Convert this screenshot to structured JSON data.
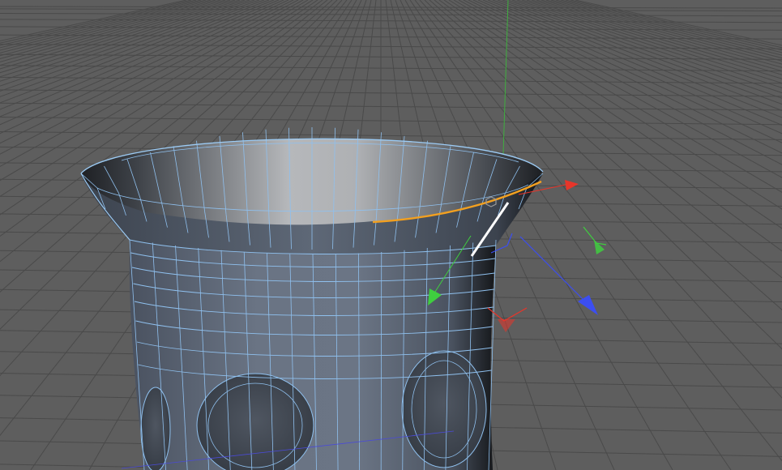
{
  "viewport": {
    "kind": "3d-perspective",
    "background_color": "#5e5e5e",
    "grid_color": "#4a4a4a",
    "wire_color": "#8fc0ee",
    "selection_color": "#f2a020",
    "active_edge_color": "#ffffff"
  },
  "axis_colors": {
    "x": "#e8352a",
    "y": "#3fce3f",
    "z": "#3c4ef0"
  },
  "icons": [
    "move-gizmo-icon",
    "x-axis-arrow-icon",
    "y-axis-arrow-icon",
    "z-axis-arrow-icon",
    "rotation-handle-icon",
    "pivot-point-icon"
  ]
}
